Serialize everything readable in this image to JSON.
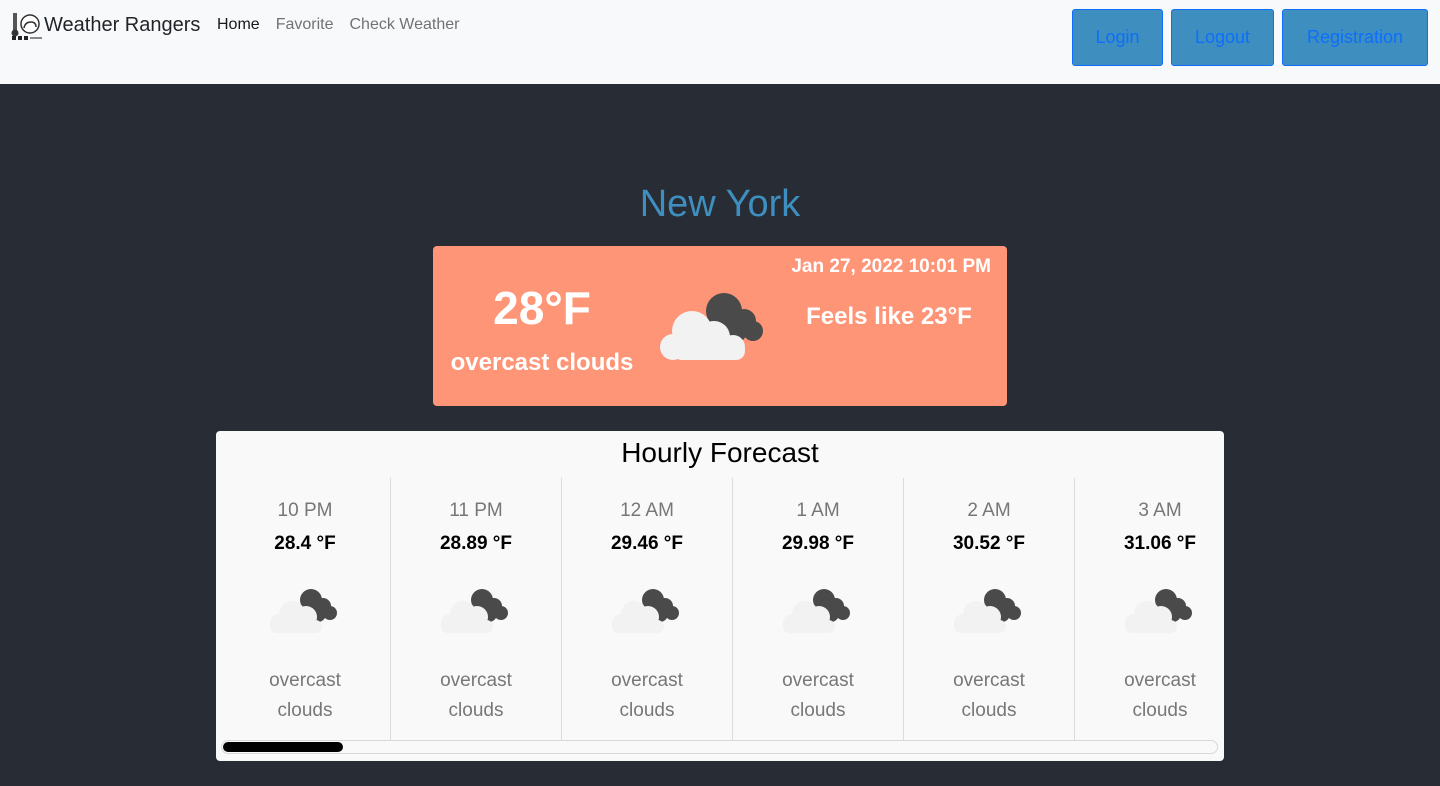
{
  "nav": {
    "brand": "Weather Rangers",
    "links": [
      "Home",
      "Favorite",
      "Check Weather"
    ],
    "buttons": {
      "login": "Login",
      "logout": "Logout",
      "register": "Registration"
    }
  },
  "city": "New York",
  "current": {
    "datetime": "Jan 27, 2022 10:01 PM",
    "temp": "28°F",
    "description": "overcast clouds",
    "feels_like": "Feels like 23°F",
    "icon": "overcast-clouds-icon"
  },
  "forecast": {
    "title": "Hourly Forecast",
    "items": [
      {
        "time": "10 PM",
        "temp": "28.4 °F",
        "desc": "overcast clouds"
      },
      {
        "time": "11 PM",
        "temp": "28.89 °F",
        "desc": "overcast clouds"
      },
      {
        "time": "12 AM",
        "temp": "29.46 °F",
        "desc": "overcast clouds"
      },
      {
        "time": "1 AM",
        "temp": "29.98 °F",
        "desc": "overcast clouds"
      },
      {
        "time": "2 AM",
        "temp": "30.52 °F",
        "desc": "overcast clouds"
      },
      {
        "time": "3 AM",
        "temp": "31.06 °F",
        "desc": "overcast clouds"
      }
    ]
  },
  "colors": {
    "background": "#282c34",
    "navbar": "#f8f9fa",
    "accent": "#3e8fbf",
    "current_card": "#ff9577",
    "button_text": "#0d6efd"
  }
}
